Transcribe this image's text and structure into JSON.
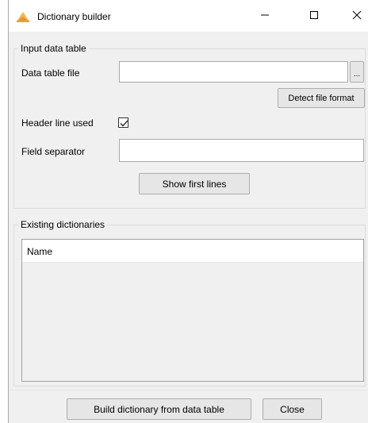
{
  "window": {
    "title": "Dictionary builder",
    "minimize_icon": "minimize-icon",
    "maximize_icon": "maximize-icon",
    "close_icon": "close-icon"
  },
  "input_group": {
    "legend": "Input data table",
    "data_table_file_label": "Data table file",
    "data_table_file_value": "",
    "browse_label": "...",
    "detect_format_label": "Detect file format",
    "header_line_label": "Header line used",
    "header_line_checked": true,
    "field_separator_label": "Field separator",
    "field_separator_value": "",
    "show_first_lines_label": "Show first lines"
  },
  "dictionaries_group": {
    "legend": "Existing dictionaries",
    "columns": [
      "Name"
    ],
    "rows": []
  },
  "footer": {
    "build_label": "Build dictionary from data table",
    "close_label": "Close"
  },
  "colors": {
    "window_bg": "#f0f0f0",
    "titlebar_bg": "#ffffff",
    "app_icon": "#f5a623"
  }
}
